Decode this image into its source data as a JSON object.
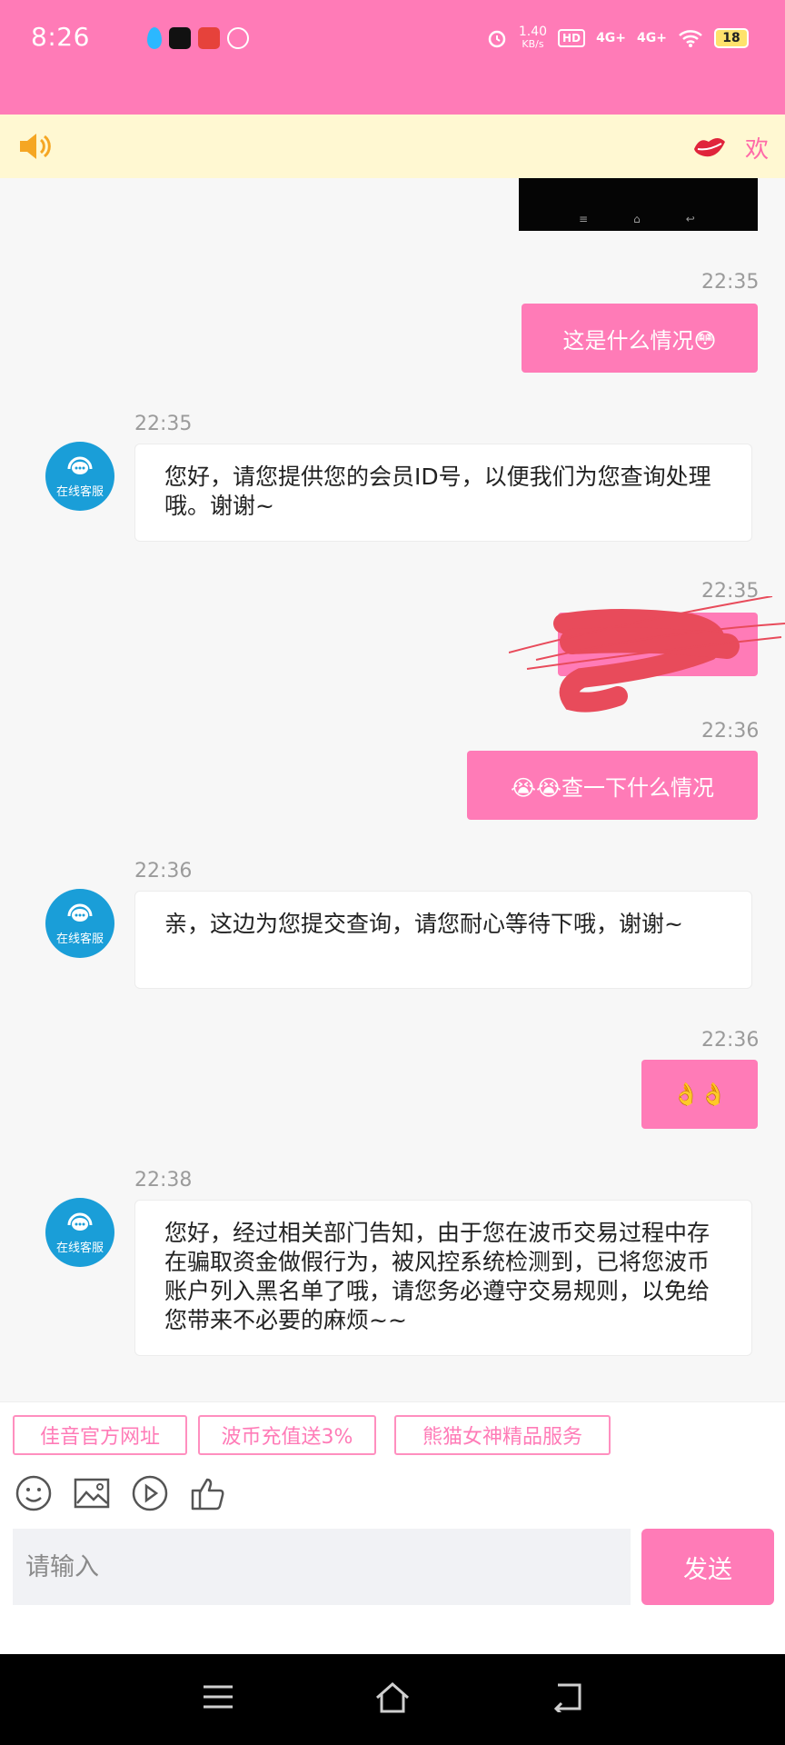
{
  "status_bar": {
    "time": "8:26",
    "speed_value": "1.40",
    "speed_unit": "KB/s",
    "hd": "HD",
    "net1": "4G+",
    "net2": "4G+",
    "battery": "18"
  },
  "notice": {
    "text": "欢"
  },
  "messages": [
    {
      "side": "out",
      "time": "22:35",
      "text": "这是什么情况😳"
    },
    {
      "side": "in",
      "time": "22:35",
      "text": "您好，请您提供您的会员ID号，以便我们为您查询处理哦。谢谢~"
    },
    {
      "side": "out",
      "time": "22:35",
      "text": ""
    },
    {
      "side": "out",
      "time": "22:36",
      "text": "😭😭查一下什么情况"
    },
    {
      "side": "in",
      "time": "22:36",
      "text": "亲，这边为您提交查询，请您耐心等待下哦，谢谢~"
    },
    {
      "side": "out",
      "time": "22:36",
      "text": "👌👌"
    },
    {
      "side": "in",
      "time": "22:38",
      "text": "您好，经过相关部门告知，由于您在波币交易过程中存在骗取资金做假行为，被风控系统检测到，已将您波币账户列入黑名单了哦，请您务必遵守交易规则，以免给您带来不必要的麻烦~~"
    }
  ],
  "agent": {
    "avatar_label": "在线客服"
  },
  "quick_links": [
    "佳音官方网址",
    "波币充值送3%",
    "熊猫女神精品服务"
  ],
  "input": {
    "placeholder": "请输入"
  },
  "send_label": "发送",
  "colors": {
    "accent": "#ff7bb7",
    "notice_bg": "#fff8d2",
    "agent_blue": "#1a9ed8"
  }
}
